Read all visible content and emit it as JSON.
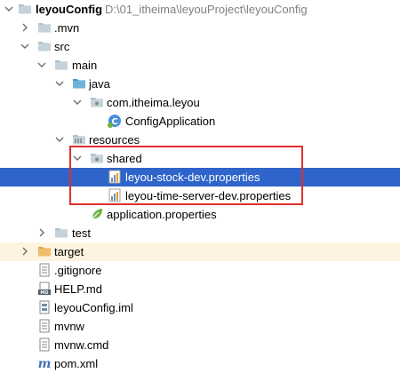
{
  "project": {
    "name": "leyouConfig",
    "path": "D:\\01_itheima\\leyouProject\\leyouConfig"
  },
  "tree": {
    "mvn": ".mvn",
    "src": "src",
    "main": "main",
    "java": "java",
    "package": "com.itheima.leyou",
    "config_app": "ConfigApplication",
    "resources": "resources",
    "shared": "shared",
    "stock_props": "leyou-stock-dev.properties",
    "time_props": "leyou-time-server-dev.properties",
    "app_props": "application.properties",
    "test": "test",
    "target": "target",
    "gitignore": ".gitignore",
    "help": "HELP.md",
    "iml": "leyouConfig.iml",
    "mvnw": "mvnw",
    "mvnw_cmd": "mvnw.cmd",
    "pom": "pom.xml"
  },
  "icons": {
    "folder_color": "#aebfc9",
    "source_folder_color": "#6fb3d9",
    "selection_color": "#2f65ca",
    "highlight_box_color": "#e0302b"
  }
}
